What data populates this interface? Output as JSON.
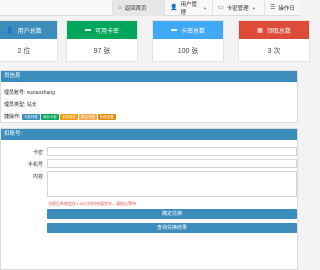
{
  "nav": {
    "items": [
      {
        "label": "返回首页",
        "icon": "home-icon"
      },
      {
        "label": "用户管理",
        "icon": "user-icon"
      },
      {
        "label": "卡密管理",
        "icon": "card-icon"
      },
      {
        "label": "操作日"
      }
    ]
  },
  "stats": [
    {
      "label": "用户总数",
      "value": "2 位",
      "icon": "user-icon",
      "color": "#3c8dbc"
    },
    {
      "label": "可用卡密",
      "value": "97 张",
      "icon": "card-icon",
      "color": "#00a65a"
    },
    {
      "label": "卡密总数",
      "value": "100 张",
      "icon": "card-icon",
      "color": "#3fa9f5"
    },
    {
      "label": "领取总数",
      "value": "3 次",
      "icon": "grid-icon",
      "color": "#dd4b39"
    }
  ],
  "info_panel": {
    "title": "员信息",
    "account_label": "理员账号:",
    "account_value": "xuxiaozhang",
    "type_label": "理员类型:",
    "type_value": "站长",
    "ops_label": "捷操作:",
    "quick_ops": [
      {
        "label": "卡密列表",
        "color": "#3c8dbc"
      },
      {
        "label": "添加卡密",
        "color": "#00a65a"
      },
      {
        "label": "卡密回收",
        "color": "#f39c12"
      },
      {
        "label": "导出卡密",
        "color": "#f0ad4e"
      },
      {
        "label": "系统设置",
        "color": "#e08e0b"
      }
    ]
  },
  "form_panel": {
    "title": "扣账号:",
    "card_label": "卡密",
    "phone_label": "手机号",
    "content_label": "内容",
    "hint": "兑换后系统会在1-24小时内充值完毕，请耐心等待",
    "confirm_button": "确定兑换",
    "query_button": "查询兑换结果"
  }
}
